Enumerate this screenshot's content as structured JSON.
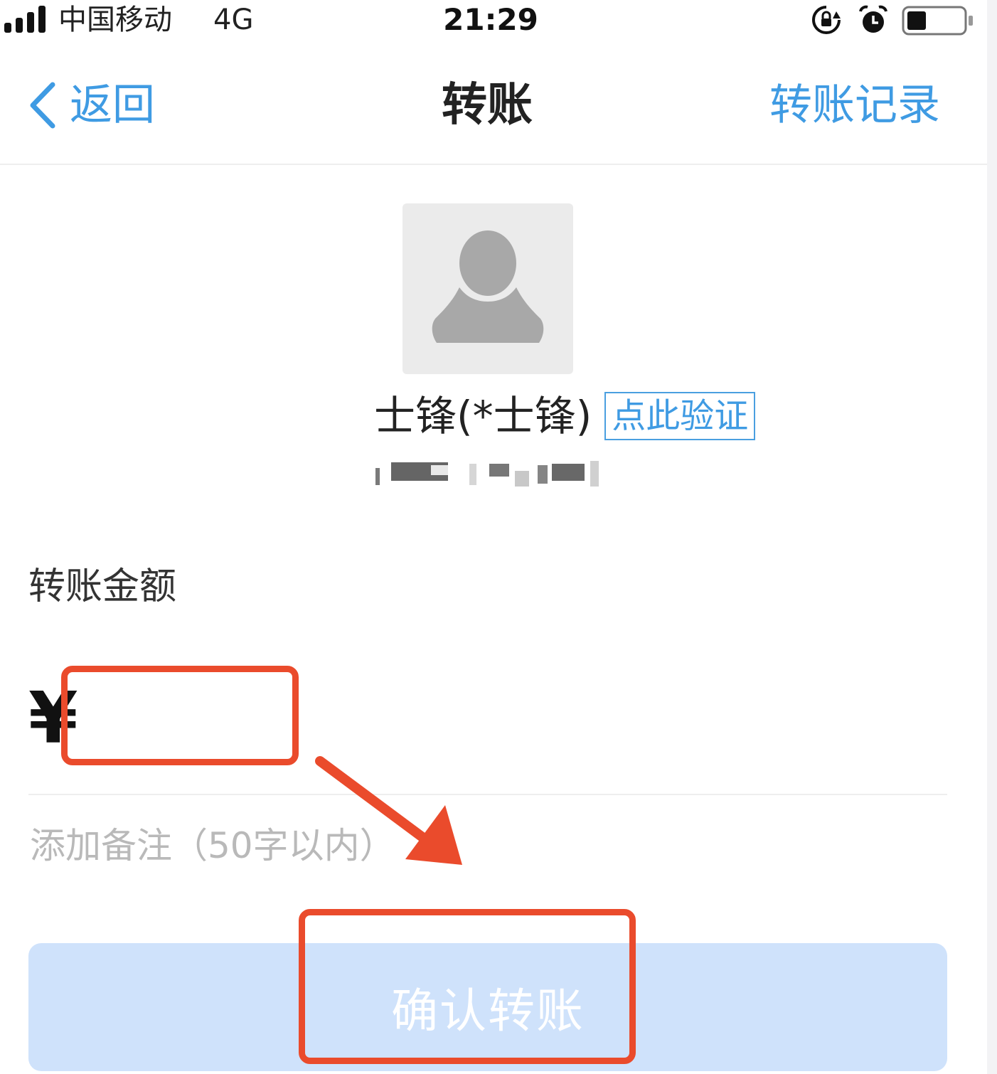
{
  "status_bar": {
    "carrier": "中国移动",
    "network": "4G",
    "time": "21:29",
    "icons": [
      "signal-icon",
      "rotation-lock-icon",
      "alarm-icon",
      "battery-icon"
    ]
  },
  "nav": {
    "back_label": "返回",
    "title": "转账",
    "right_link": "转账记录"
  },
  "recipient": {
    "avatar": "default-avatar-icon",
    "name": "士锋(*士锋)",
    "verify_label": "点此验证"
  },
  "amount": {
    "label": "转账金额",
    "currency": "¥",
    "value": ""
  },
  "note": {
    "placeholder": "添加备注（50字以内）",
    "value": ""
  },
  "confirm": {
    "label": "确认转账"
  },
  "colors": {
    "accent": "#3f9be3",
    "confirm_disabled_bg": "#cfe2fb",
    "annotation_red": "#ea4b2c"
  }
}
